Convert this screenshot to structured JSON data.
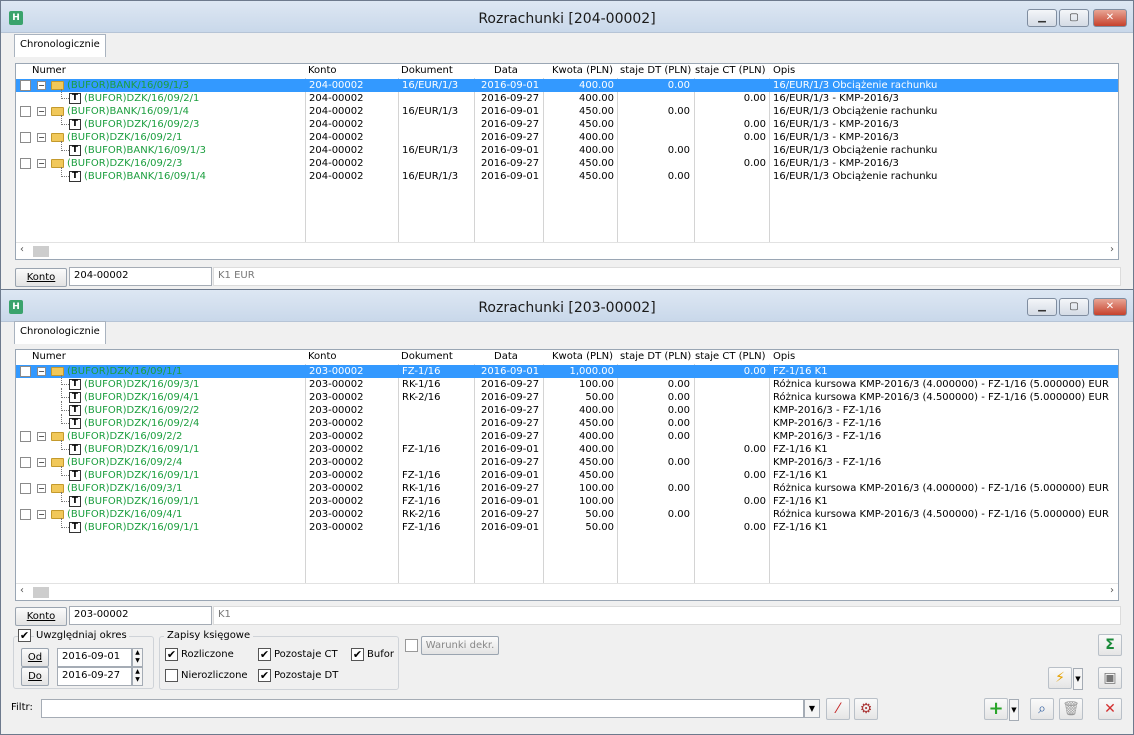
{
  "windows": [
    {
      "title": "Rozrachunki [204-00002]",
      "tab": "Chronologicznie",
      "columns": [
        "Numer",
        "Konto",
        "Dokument",
        "Data",
        "Kwota (PLN)",
        "staje DT (PLN)",
        "staje CT (PLN)",
        "Opis"
      ],
      "konto_label": "Konto",
      "konto_value": "204-00002",
      "konto_desc": "K1 EUR",
      "rows": [
        {
          "level": 0,
          "selected": true,
          "checkbox": true,
          "folder": true,
          "numer": "(BUFOR)BANK/16/09/1/3",
          "konto": "204-00002",
          "dokument": "16/EUR/1/3",
          "data": "2016-09-01",
          "kwota": "400.00",
          "dt": "0.00",
          "ct": "",
          "opis": "16/EUR/1/3 Obciążenie rachunku"
        },
        {
          "level": 1,
          "numer": "(BUFOR)DZK/16/09/2/1",
          "konto": "204-00002",
          "dokument": "",
          "data": "2016-09-27",
          "kwota": "400.00",
          "dt": "",
          "ct": "0.00",
          "opis": "16/EUR/1/3 - KMP-2016/3"
        },
        {
          "level": 0,
          "checkbox": true,
          "folder": true,
          "numer": "(BUFOR)BANK/16/09/1/4",
          "konto": "204-00002",
          "dokument": "16/EUR/1/3",
          "data": "2016-09-01",
          "kwota": "450.00",
          "dt": "0.00",
          "ct": "",
          "opis": "16/EUR/1/3 Obciążenie rachunku"
        },
        {
          "level": 1,
          "numer": "(BUFOR)DZK/16/09/2/3",
          "konto": "204-00002",
          "dokument": "",
          "data": "2016-09-27",
          "kwota": "450.00",
          "dt": "",
          "ct": "0.00",
          "opis": "16/EUR/1/3 - KMP-2016/3"
        },
        {
          "level": 0,
          "checkbox": true,
          "folder": true,
          "numer": "(BUFOR)DZK/16/09/2/1",
          "konto": "204-00002",
          "dokument": "",
          "data": "2016-09-27",
          "kwota": "400.00",
          "dt": "",
          "ct": "0.00",
          "opis": "16/EUR/1/3 - KMP-2016/3"
        },
        {
          "level": 1,
          "numer": "(BUFOR)BANK/16/09/1/3",
          "konto": "204-00002",
          "dokument": "16/EUR/1/3",
          "data": "2016-09-01",
          "kwota": "400.00",
          "dt": "0.00",
          "ct": "",
          "opis": "16/EUR/1/3 Obciążenie rachunku"
        },
        {
          "level": 0,
          "checkbox": true,
          "folder": true,
          "numer": "(BUFOR)DZK/16/09/2/3",
          "konto": "204-00002",
          "dokument": "",
          "data": "2016-09-27",
          "kwota": "450.00",
          "dt": "",
          "ct": "0.00",
          "opis": "16/EUR/1/3 - KMP-2016/3"
        },
        {
          "level": 1,
          "numer": "(BUFOR)BANK/16/09/1/4",
          "konto": "204-00002",
          "dokument": "16/EUR/1/3",
          "data": "2016-09-01",
          "kwota": "450.00",
          "dt": "0.00",
          "ct": "",
          "opis": "16/EUR/1/3 Obciążenie rachunku"
        }
      ]
    },
    {
      "title": "Rozrachunki [203-00002]",
      "tab": "Chronologicznie",
      "columns": [
        "Numer",
        "Konto",
        "Dokument",
        "Data",
        "Kwota (PLN)",
        "staje DT (PLN)",
        "staje CT (PLN)",
        "Opis"
      ],
      "konto_label": "Konto",
      "konto_value": "203-00002",
      "konto_desc": "K1",
      "rows": [
        {
          "level": 0,
          "selected": true,
          "checkbox": true,
          "folder": true,
          "numer": "(BUFOR)DZK/16/09/1/1",
          "konto": "203-00002",
          "dokument": "FZ-1/16",
          "data": "2016-09-01",
          "kwota": "1,000.00",
          "dt": "",
          "ct": "0.00",
          "opis": "FZ-1/16 K1"
        },
        {
          "level": 1,
          "numer": "(BUFOR)DZK/16/09/3/1",
          "konto": "203-00002",
          "dokument": "RK-1/16",
          "data": "2016-09-27",
          "kwota": "100.00",
          "dt": "0.00",
          "ct": "",
          "opis": "Różnica kursowa KMP-2016/3 (4.000000) - FZ-1/16 (5.000000) EUR"
        },
        {
          "level": 1,
          "numer": "(BUFOR)DZK/16/09/4/1",
          "konto": "203-00002",
          "dokument": "RK-2/16",
          "data": "2016-09-27",
          "kwota": "50.00",
          "dt": "0.00",
          "ct": "",
          "opis": "Różnica kursowa KMP-2016/3 (4.500000) - FZ-1/16 (5.000000) EUR"
        },
        {
          "level": 1,
          "numer": "(BUFOR)DZK/16/09/2/2",
          "konto": "203-00002",
          "dokument": "",
          "data": "2016-09-27",
          "kwota": "400.00",
          "dt": "0.00",
          "ct": "",
          "opis": "KMP-2016/3 - FZ-1/16"
        },
        {
          "level": 1,
          "numer": "(BUFOR)DZK/16/09/2/4",
          "konto": "203-00002",
          "dokument": "",
          "data": "2016-09-27",
          "kwota": "450.00",
          "dt": "0.00",
          "ct": "",
          "opis": "KMP-2016/3 - FZ-1/16"
        },
        {
          "level": 0,
          "checkbox": true,
          "folder": true,
          "numer": "(BUFOR)DZK/16/09/2/2",
          "konto": "203-00002",
          "dokument": "",
          "data": "2016-09-27",
          "kwota": "400.00",
          "dt": "0.00",
          "ct": "",
          "opis": "KMP-2016/3 - FZ-1/16"
        },
        {
          "level": 1,
          "numer": "(BUFOR)DZK/16/09/1/1",
          "konto": "203-00002",
          "dokument": "FZ-1/16",
          "data": "2016-09-01",
          "kwota": "400.00",
          "dt": "",
          "ct": "0.00",
          "opis": "FZ-1/16 K1"
        },
        {
          "level": 0,
          "checkbox": true,
          "folder": true,
          "numer": "(BUFOR)DZK/16/09/2/4",
          "konto": "203-00002",
          "dokument": "",
          "data": "2016-09-27",
          "kwota": "450.00",
          "dt": "0.00",
          "ct": "",
          "opis": "KMP-2016/3 - FZ-1/16"
        },
        {
          "level": 1,
          "numer": "(BUFOR)DZK/16/09/1/1",
          "konto": "203-00002",
          "dokument": "FZ-1/16",
          "data": "2016-09-01",
          "kwota": "450.00",
          "dt": "",
          "ct": "0.00",
          "opis": "FZ-1/16 K1"
        },
        {
          "level": 0,
          "checkbox": true,
          "folder": true,
          "numer": "(BUFOR)DZK/16/09/3/1",
          "konto": "203-00002",
          "dokument": "RK-1/16",
          "data": "2016-09-27",
          "kwota": "100.00",
          "dt": "0.00",
          "ct": "",
          "opis": "Różnica kursowa KMP-2016/3 (4.000000) - FZ-1/16 (5.000000) EUR"
        },
        {
          "level": 1,
          "numer": "(BUFOR)DZK/16/09/1/1",
          "konto": "203-00002",
          "dokument": "FZ-1/16",
          "data": "2016-09-01",
          "kwota": "100.00",
          "dt": "",
          "ct": "0.00",
          "opis": "FZ-1/16 K1"
        },
        {
          "level": 0,
          "checkbox": true,
          "folder": true,
          "numer": "(BUFOR)DZK/16/09/4/1",
          "konto": "203-00002",
          "dokument": "RK-2/16",
          "data": "2016-09-27",
          "kwota": "50.00",
          "dt": "0.00",
          "ct": "",
          "opis": "Różnica kursowa KMP-2016/3 (4.500000) - FZ-1/16 (5.000000) EUR"
        },
        {
          "level": 1,
          "numer": "(BUFOR)DZK/16/09/1/1",
          "konto": "203-00002",
          "dokument": "FZ-1/16",
          "data": "2016-09-01",
          "kwota": "50.00",
          "dt": "",
          "ct": "0.00",
          "opis": "FZ-1/16 K1"
        }
      ]
    }
  ],
  "filters": {
    "uwzgledniaj_label": "Uwzględniaj okres",
    "uwzgledniaj_checked": true,
    "od_label": "Od",
    "od_value": "2016-09-01",
    "do_label": "Do",
    "do_value": "2016-09-27",
    "zapisy_title": "Zapisy księgowe",
    "rozliczone_label": "Rozliczone",
    "rozliczone_checked": true,
    "pozostaje_ct_label": "Pozostaje CT",
    "pozostaje_ct_checked": true,
    "bufor_label": "Bufor",
    "bufor_checked": true,
    "nierozliczone_label": "Nierozliczone",
    "nierozliczone_checked": false,
    "pozostaje_dt_label": "Pozostaje DT",
    "pozostaje_dt_checked": true,
    "warunki_label": "Warunki dekr.",
    "warunki_checked": false,
    "filtr_label": "Filtr:",
    "filtr_value": ""
  },
  "icons": {
    "app": "app-logo-icon",
    "sum": "sigma-icon",
    "lightning": "lightning-icon",
    "add": "add-icon",
    "search": "search-icon",
    "delete": "trash-icon",
    "close": "close-x-icon"
  },
  "colors": {
    "selection": "#3399ff",
    "buffer_text": "#1b9e3e",
    "close_red": "#c6412c"
  }
}
